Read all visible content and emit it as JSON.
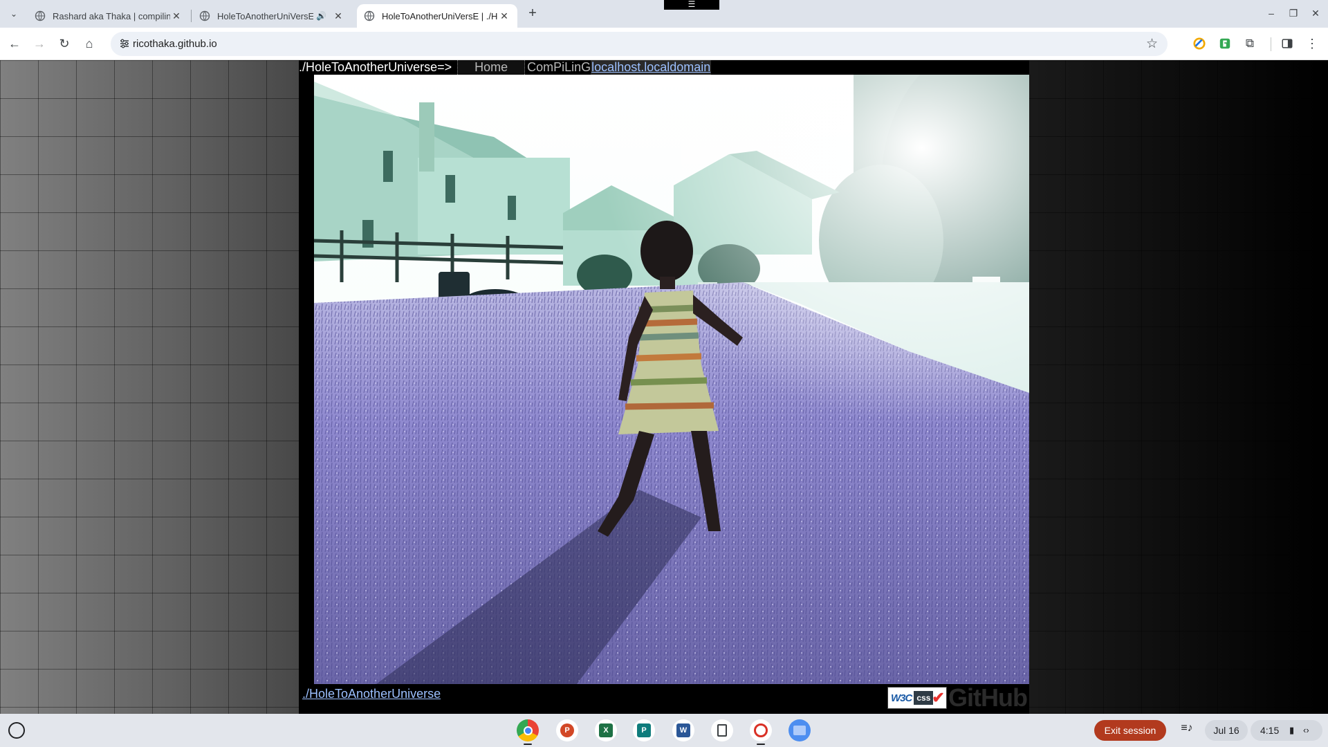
{
  "browser": {
    "tabs": [
      {
        "title": "Rashard aka Thaka | compiling",
        "active": false,
        "audio": false
      },
      {
        "title": "HoleToAnotherUniVersE | ./",
        "active": false,
        "audio": true
      },
      {
        "title": "HoleToAnotherUniVersE | ./Hol",
        "active": true,
        "audio": false
      }
    ],
    "url": "ricothaka.github.io"
  },
  "page": {
    "site_title": "./HoleToAnotherUniverse=>",
    "nav": {
      "home": "Home",
      "compiling": "ComPiLinG",
      "localhost": "localhost.localdomain"
    },
    "footer_link": "./HoleToAnotherUniverse",
    "badges": {
      "w3c": "W3C",
      "css": "css",
      "github": "GitHub"
    }
  },
  "shelf": {
    "exit_session": "Exit session",
    "date": "Jul 16",
    "time": "4:15"
  }
}
